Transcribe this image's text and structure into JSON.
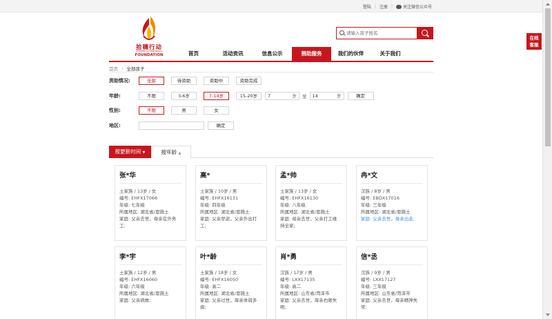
{
  "topbar": {
    "login": "登陆",
    "register": "注册",
    "wechat": "关注微信公众号"
  },
  "logo": {
    "cn": "拾穗行动",
    "en": "Children's Emergency",
    "en2": "FOUNDATION",
    "flame_colors": [
      "#c8161d",
      "#f08c00",
      "#f5b700"
    ]
  },
  "search": {
    "placeholder": "请输入孩子姓名"
  },
  "nav": [
    {
      "label": "首页",
      "active": false
    },
    {
      "label": "活动资讯",
      "active": false
    },
    {
      "label": "信息公示",
      "active": false
    },
    {
      "label": "捐助服务",
      "active": true
    },
    {
      "label": "我们的伙伴",
      "active": false
    },
    {
      "label": "关于我们",
      "active": false
    }
  ],
  "side_tab": {
    "line1": "在线",
    "line2": "客服"
  },
  "breadcrumb": {
    "home": "首页",
    "sep": "/",
    "current": "全部孩子"
  },
  "filters": {
    "status": {
      "label": "资助情况:",
      "options": [
        "全部",
        "待资助",
        "资助中",
        "资助完成"
      ],
      "selected": 0
    },
    "age": {
      "label": "年龄:",
      "options": [
        "不限",
        "3-6岁",
        "7-14岁",
        "15-20岁"
      ],
      "selected": 2,
      "from": "7",
      "to": "14",
      "unit": "岁",
      "to_label": "至",
      "confirm": "确定"
    },
    "gender": {
      "label": "性别:",
      "options": [
        "不限",
        "男",
        "女"
      ],
      "selected": 0
    },
    "region": {
      "label": "地区:",
      "value": "",
      "confirm": "确定"
    }
  },
  "sort": {
    "by_time": "按更新时间",
    "by_age": "按年龄",
    "arrow_down": "▼",
    "arrow_sort": "▲"
  },
  "colors": {
    "brand": "#c8161d",
    "link": "#3a8fd8"
  },
  "children": [
    {
      "name": "张*华",
      "info": "土家族 / 13岁 / 女",
      "id": "编号: EHFX17066",
      "grade": "年级: 七年级",
      "region": "所属地区: 湖北省/恩施土",
      "family1": "家庭: 父亲去世，母亲在外务",
      "family2": "工;",
      "blue": false
    },
    {
      "name": "高*",
      "info": "土家族 / 10岁 / 男",
      "id": "编号: EHFX16131",
      "grade": "年级: 四年级",
      "region": "所属地区: 湖北省/恩施土",
      "family1": "家庭: 父亲早逝，父亲外出打",
      "family2": "工;",
      "blue": false
    },
    {
      "name": "孟*帅",
      "info": "土家族 / 13岁 / 女",
      "id": "编号: EHFX16130",
      "grade": "年级: 八年级",
      "region": "所属地区: 湖北省/恩施土",
      "family1": "家庭: 母亲去世，父亲打工维",
      "family2": "持全家;",
      "blue": false
    },
    {
      "name": "冉*文",
      "info": "汉族 / 8岁 / 男",
      "id": "编号: EBDX17016",
      "grade": "年级: 三年级",
      "region": "所属地区: 湖北省/恩施土",
      "family1": "家庭: 父亲去世，母亲出走;",
      "family2": "",
      "blue": true
    },
    {
      "name": "李*宇",
      "info": "土家族 / 12岁 / 男",
      "id": "编号: EHFX16060",
      "grade": "年级: 六年级",
      "region": "所属地区: 湖北省/恩施土",
      "family1": "家庭: 父亲病故;",
      "family2": "",
      "blue": false
    },
    {
      "name": "叶*龄",
      "info": "土家族 / 18岁 / 女",
      "id": "编号: EHFX16050",
      "grade": "年级: 高二",
      "region": "所属地区: 湖北省/恩施土",
      "family1": "家庭: 父亲过世，母亲体弱多",
      "family2": "病;",
      "blue": false
    },
    {
      "name": "肖*勇",
      "info": "汉族 / 17岁 / 男",
      "id": "编号: LXX17135",
      "grade": "年级: 高二",
      "region": "所属地区: 山东省/菏泽市",
      "family1": "家庭: 父亲去世，母亲右眼失",
      "family2": "明;",
      "blue": false
    },
    {
      "name": "信*丞",
      "info": "汉族 / 9岁 / 男",
      "id": "编号: LXX17127",
      "grade": "年级: 三年级",
      "region": "所属地区: 山东省/菏泽市",
      "family1": "家庭: 父亲去世，母亲精神失",
      "family2": "常;",
      "blue": false
    }
  ]
}
